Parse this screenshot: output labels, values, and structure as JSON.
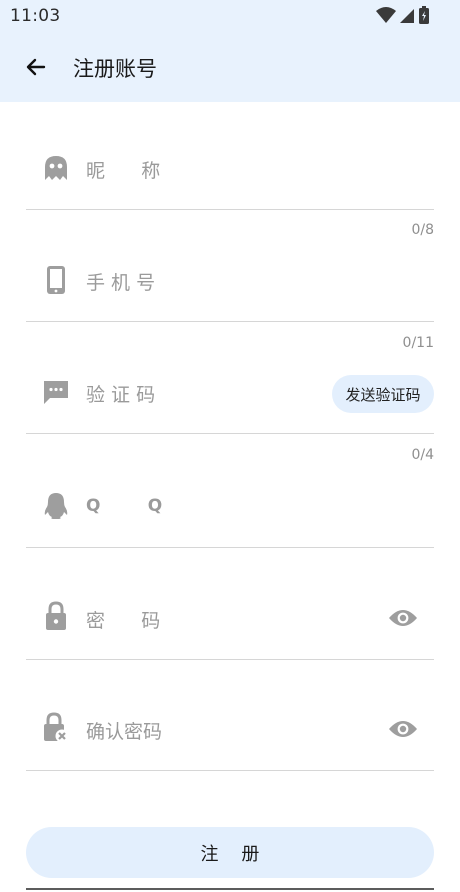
{
  "status_bar": {
    "time": "11:03"
  },
  "app_bar": {
    "title": "注册账号"
  },
  "form": {
    "nickname": {
      "label": "昵      称",
      "counter": "0/8",
      "value": ""
    },
    "phone": {
      "label": "手 机 号",
      "counter": "0/11",
      "value": ""
    },
    "code": {
      "label": "验 证 码",
      "counter": "0/4",
      "send_label": "发送验证码",
      "value": ""
    },
    "qq": {
      "label": "Q        Q",
      "value": ""
    },
    "password": {
      "label": "密      码",
      "value": ""
    },
    "confirm_password": {
      "label": "确认密码",
      "value": ""
    }
  },
  "register_button": {
    "label": "注    册"
  },
  "icons": {
    "back": "arrow-left-icon",
    "nickname": "ghost-icon",
    "phone": "smartphone-icon",
    "code": "message-dots-icon",
    "qq": "qq-penguin-icon",
    "password": "lock-icon",
    "confirm_password": "lock-x-icon",
    "visibility": "eye-icon"
  },
  "colors": {
    "header_bg": "#e8f2fd",
    "button_bg": "#e3effd",
    "icon_gray": "#9e9e9e",
    "placeholder": "#9a9a9a"
  }
}
